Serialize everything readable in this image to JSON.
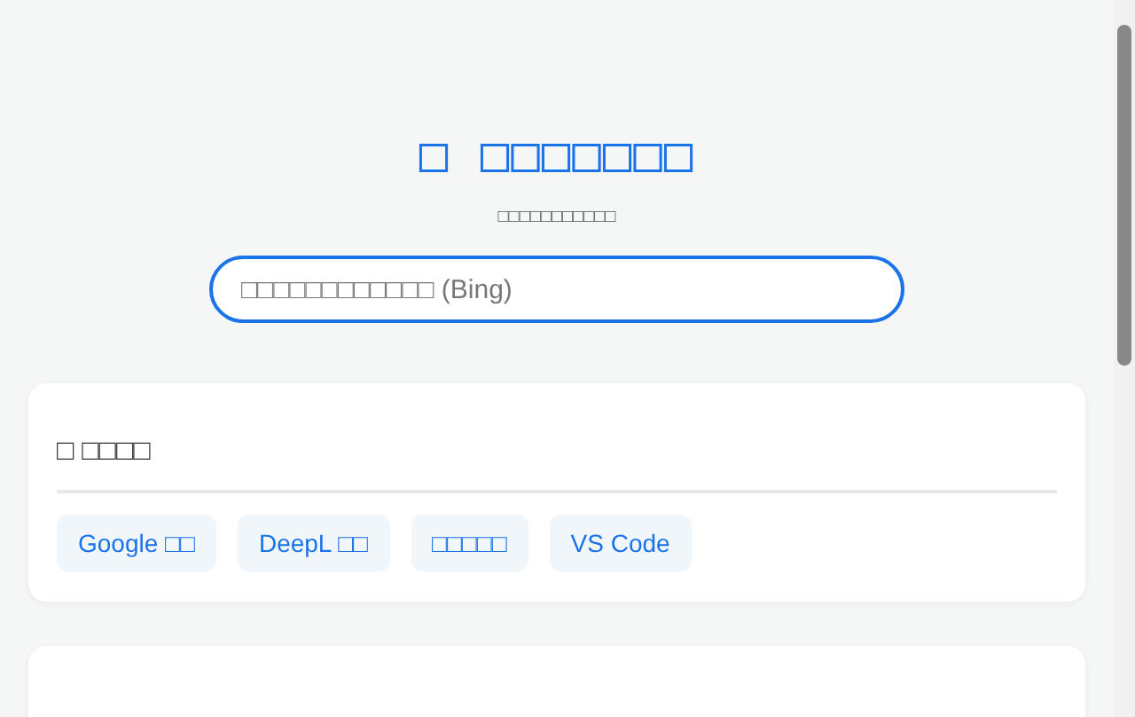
{
  "header": {
    "title": "□ □□□□□□□",
    "subtitle": "□□□□□□□□□□□"
  },
  "search": {
    "placeholder": "□□□□□□□□□□□□ (Bing)"
  },
  "sections": [
    {
      "title": "□ □□□□",
      "links": [
        "Google □□",
        "DeepL □□",
        "□□□□□",
        "VS Code"
      ]
    }
  ]
}
